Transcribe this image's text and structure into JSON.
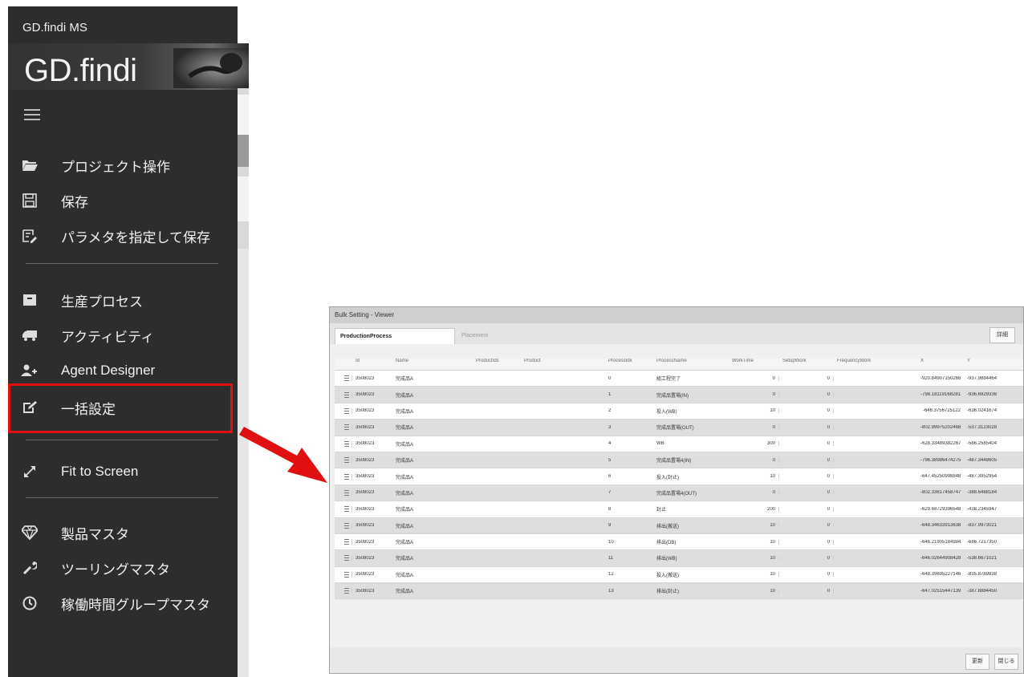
{
  "app": {
    "title": "GD.findi MS",
    "logo": "GD.findi"
  },
  "menu": {
    "items": [
      {
        "label": "プロジェクト操作",
        "icon": "folder-open-icon"
      },
      {
        "label": "保存",
        "icon": "save-icon"
      },
      {
        "label": "パラメタを指定して保存",
        "icon": "save-with-params-icon"
      },
      {
        "label": "生産プロセス",
        "icon": "archive-box-icon"
      },
      {
        "label": "アクティビティ",
        "icon": "truck-icon"
      },
      {
        "label": "Agent Designer",
        "icon": "user-plus-icon"
      },
      {
        "label": "一括設定",
        "icon": "edit-icon"
      },
      {
        "label": "Fit to Screen",
        "icon": "expand-arrows-icon"
      },
      {
        "label": "製品マスタ",
        "icon": "diamond-icon"
      },
      {
        "label": "ツーリングマスタ",
        "icon": "wrench-icon"
      },
      {
        "label": "稼働時間グループマスタ",
        "icon": "clock-icon"
      }
    ]
  },
  "dialog": {
    "title": "Bulk Setting - Viewer",
    "tabs": [
      "ProductionProcess",
      "Placement"
    ],
    "detail_button": "詳細",
    "columns": [
      "Id",
      "Name",
      "ProductIds",
      "Product",
      "ProcessIdx",
      "ProcessName",
      "WorkTime",
      "SetupWork",
      "FrequencyWork",
      "X",
      "Y"
    ],
    "rows": [
      {
        "id": "3508023",
        "name": "完成品A",
        "idx": "0",
        "process": "組工程完了",
        "work": "0",
        "setup": "0",
        "x": "-920.84907150268",
        "y": "-937.9884464"
      },
      {
        "id": "3508023",
        "name": "完成品A",
        "idx": "1",
        "process": "完成品置場(IN)",
        "work": "0",
        "setup": "0",
        "x": "-798.18119168281",
        "y": "-936.6929336"
      },
      {
        "id": "3508023",
        "name": "完成品A",
        "idx": "2",
        "process": "投入(WB)",
        "work": "10",
        "setup": "0",
        "x": "-646.3756725122",
        "y": "-636.0241674"
      },
      {
        "id": "3508023",
        "name": "完成品A",
        "idx": "3",
        "process": "完成品置場(OUT)",
        "work": "0",
        "setup": "0",
        "x": "-802.99975202468",
        "y": "-537.3123028"
      },
      {
        "id": "3508023",
        "name": "完成品A",
        "idx": "4",
        "process": "WB",
        "work": "300",
        "setup": "0",
        "x": "-628.33489382267",
        "y": "-586.2585404"
      },
      {
        "id": "3508023",
        "name": "完成品A",
        "idx": "5",
        "process": "完成品置場4(IN)",
        "work": "0",
        "setup": "0",
        "x": "-796.38986474275",
        "y": "-487.3448605"
      },
      {
        "id": "3508023",
        "name": "完成品A",
        "idx": "6",
        "process": "投入(封止)",
        "work": "10",
        "setup": "0",
        "x": "-647.45250998848",
        "y": "-487.3952954"
      },
      {
        "id": "3508023",
        "name": "完成品A",
        "idx": "7",
        "process": "完成品置場4(OUT)",
        "work": "0",
        "setup": "0",
        "x": "-802.33617458747",
        "y": "-388.6488184"
      },
      {
        "id": "3508023",
        "name": "完成品A",
        "idx": "8",
        "process": "封止",
        "work": "200",
        "setup": "0",
        "x": "-629.68729396548",
        "y": "-438.2345947"
      },
      {
        "id": "3508023",
        "name": "完成品A",
        "idx": "9",
        "process": "排出(搬送)",
        "work": "10",
        "setup": "0",
        "x": "-648.34633913638",
        "y": "-837.9973021"
      },
      {
        "id": "3508023",
        "name": "完成品A",
        "idx": "10",
        "process": "排出(DB)",
        "work": "10",
        "setup": "0",
        "x": "-646.21905184984",
        "y": "-686.7217350"
      },
      {
        "id": "3508023",
        "name": "完成品A",
        "idx": "11",
        "process": "排出(WB)",
        "work": "10",
        "setup": "0",
        "x": "-646.02644908428",
        "y": "-538.6671021"
      },
      {
        "id": "3508023",
        "name": "完成品A",
        "idx": "12",
        "process": "投入(搬送)",
        "work": "10",
        "setup": "0",
        "x": "-648.39695227146",
        "y": "-835.8789838"
      },
      {
        "id": "3508023",
        "name": "完成品A",
        "idx": "13",
        "process": "排出(封止)",
        "work": "10",
        "setup": "0",
        "x": "-647.02515447139",
        "y": "-387.8884450"
      }
    ],
    "footer": {
      "update": "更新",
      "close": "閉じる"
    }
  },
  "colors": {
    "sidebar": "#2d2d2d",
    "highlight": "#e01010",
    "arrow": "#e01010"
  }
}
